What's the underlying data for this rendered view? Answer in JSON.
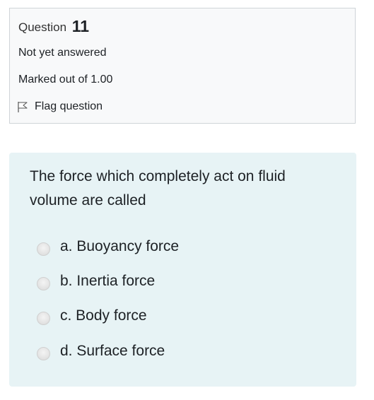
{
  "question_info": {
    "title_prefix": "Question",
    "number": "11",
    "state": "Not yet answered",
    "grade": "Marked out of 1.00",
    "flag_label": "Flag question"
  },
  "question": {
    "text": "The force which completely act on fluid volume are called",
    "answers": [
      {
        "label": "a. Buoyancy force",
        "selected": false
      },
      {
        "label": "b. Inertia force",
        "selected": false
      },
      {
        "label": "c. Body force",
        "selected": false
      },
      {
        "label": "d. Surface force",
        "selected": false
      }
    ]
  },
  "colors": {
    "info_background": "#f8f9fa",
    "info_border": "#cfd4d8",
    "content_background": "#e7f3f5",
    "text": "#1d2125"
  },
  "icons": {
    "flag": "flag-icon",
    "radio": "radio-button"
  }
}
